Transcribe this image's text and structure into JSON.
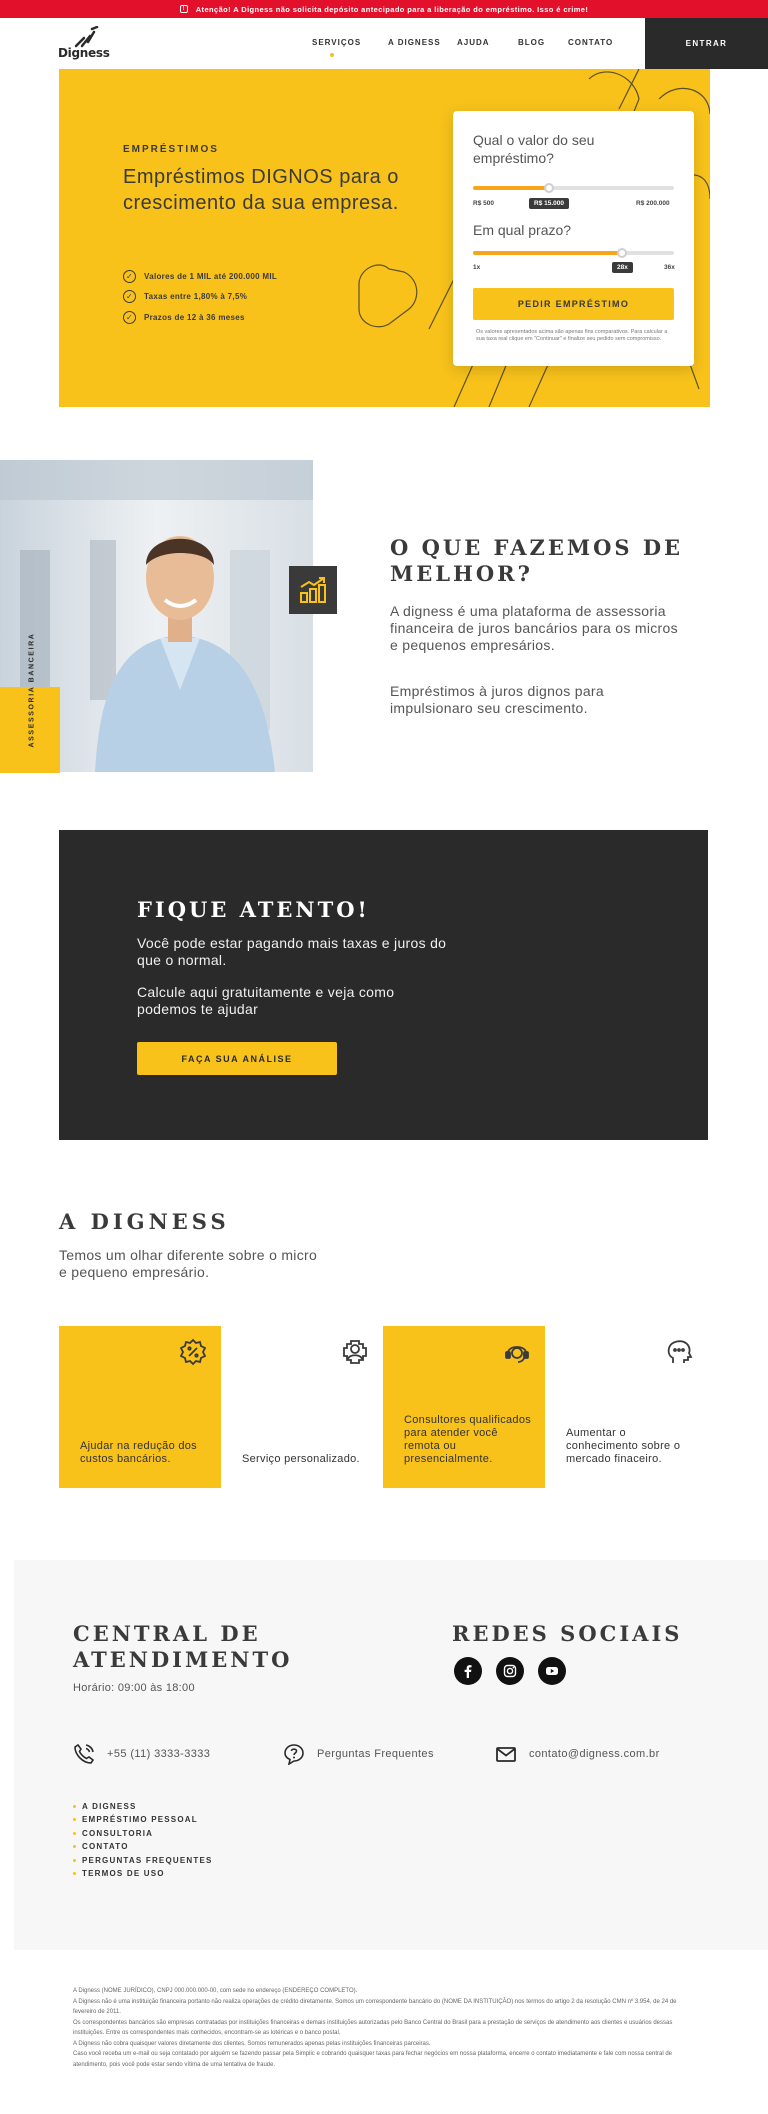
{
  "alert": {
    "icon": "alert-icon",
    "text": "Atenção! A Digness não solicita depósito antecipado para a liberação do empréstimo. Isso é crime!"
  },
  "header": {
    "logo_text": "Digness",
    "nav": [
      "SERVIÇOS",
      "A DIGNESS",
      "AJUDA",
      "BLOG",
      "CONTATO"
    ],
    "active_index": 0,
    "enter_label": "ENTRAR"
  },
  "hero": {
    "eyebrow": "EMPRÉSTIMOS",
    "title": "Empréstimos DIGNOS para o crescimento da sua empresa.",
    "checks": [
      "Valores de 1 MIL até 200.000 MIL",
      "Taxas entre 1,80% à 7,5%",
      "Prazos de 12 à 36 meses"
    ]
  },
  "simulator": {
    "amount_question": "Qual o valor do seu empréstimo?",
    "amount_min": "R$ 500",
    "amount_value": "R$ 15.000",
    "amount_max": "R$ 200.000",
    "amount_fraction": 0.38,
    "term_question": "Em qual prazo?",
    "term_min": "1x",
    "term_value": "28x",
    "term_max": "36x",
    "term_fraction": 0.74,
    "button": "PEDIR EMPRÉSTIMO",
    "note": "Os valores apresentados acima são apenas fins comparativos. Para calcular a sua taxa real clique em \"Continuar\" e finalize seu pedido sem compromisso."
  },
  "what": {
    "side_label": "ASSESSORIA BANCEIRA",
    "title": "O QUE FAZEMOS DE MELHOR?",
    "paragraph1": "A digness é uma plataforma de assessoria financeira de juros bancários para os micros e pequenos empresários.",
    "paragraph2": "Empréstimos à juros dignos para impulsionaro seu crescimento."
  },
  "cta": {
    "title": "FIQUE ATENTO!",
    "paragraph1": "Você pode estar pagando mais taxas e juros do que o normal.",
    "paragraph2": "Calcule aqui gratuitamente e veja como podemos te ajudar",
    "button": "FAÇA SUA ANÁLISE"
  },
  "about": {
    "title": "A DIGNESS",
    "subtitle": "Temos um olhar diferente sobre o micro e pequeno empresário.",
    "features": [
      {
        "icon": "discount-badge-icon",
        "text": "Ajudar na redução dos custos bancários."
      },
      {
        "icon": "user-support-icon",
        "text": "Serviço personalizado."
      },
      {
        "icon": "headset-agent-icon",
        "text": "Consultores qualificados para atender você remota ou presencialmente."
      },
      {
        "icon": "head-idea-icon",
        "text": "Aumentar o conhecimento sobre o mercado finaceiro."
      }
    ]
  },
  "footer": {
    "support_title": "CENTRAL DE ATENDIMENTO",
    "hours": "Horário: 09:00 às 18:00",
    "social_title": "REDES SOCIAIS",
    "social": [
      "facebook-icon",
      "instagram-icon",
      "youtube-icon"
    ],
    "phone": "+55 (11) 3333-3333",
    "faq": "Perguntas Frequentes",
    "email": "contato@digness.com.br",
    "links": [
      "A DIGNESS",
      "EMPRÉSTIMO PESSOAL",
      "CONSULTORIA",
      "CONTATO",
      "PERGUNTAS FREQUENTES",
      "TERMOS DE USO"
    ]
  },
  "legal": [
    "A Digness (NOME JURÍDICO), CNPJ 000.000.000-00, com sede no endereço (ENDEREÇO COMPLETO).",
    "A Digness não é uma instituição financeira portanto não realiza operações de crédito diretamente. Somos um correspondente bancário do (NOME DA INSTITUIÇÃO) nos termos do artigo 2 da resolução CMN nº 3.954, de 24 de fevereiro de 2011.",
    "Os correspondentes bancários são empresas contratadas por instituições financeiras e demais instituições autorizadas pelo Banco Central do Brasil para a prestação de serviços de atendimento aos clientes e usuários dessas instituições. Entre os correspondentes mais conhecidos, encontram-se as lotéricas e o banco postal.",
    "A Digness não cobra quaisquer valores diretamente dos clientes. Somos remunerados apenas pelas instituições financeiras parceiras.",
    "Caso você receba um e-mail ou seja contatado por alguém se fazendo passar pela Simplic e cobrando quaisquer taxas para fechar negócios em nossa plataforma, encerre o contato imediatamente e fale com nossa central de atendimento, pois você pode estar sendo vítima de uma tentativa de fraude."
  ],
  "colors": {
    "accent": "#f8c21b",
    "dark": "#2a2a2a",
    "alert": "#e3102c"
  }
}
